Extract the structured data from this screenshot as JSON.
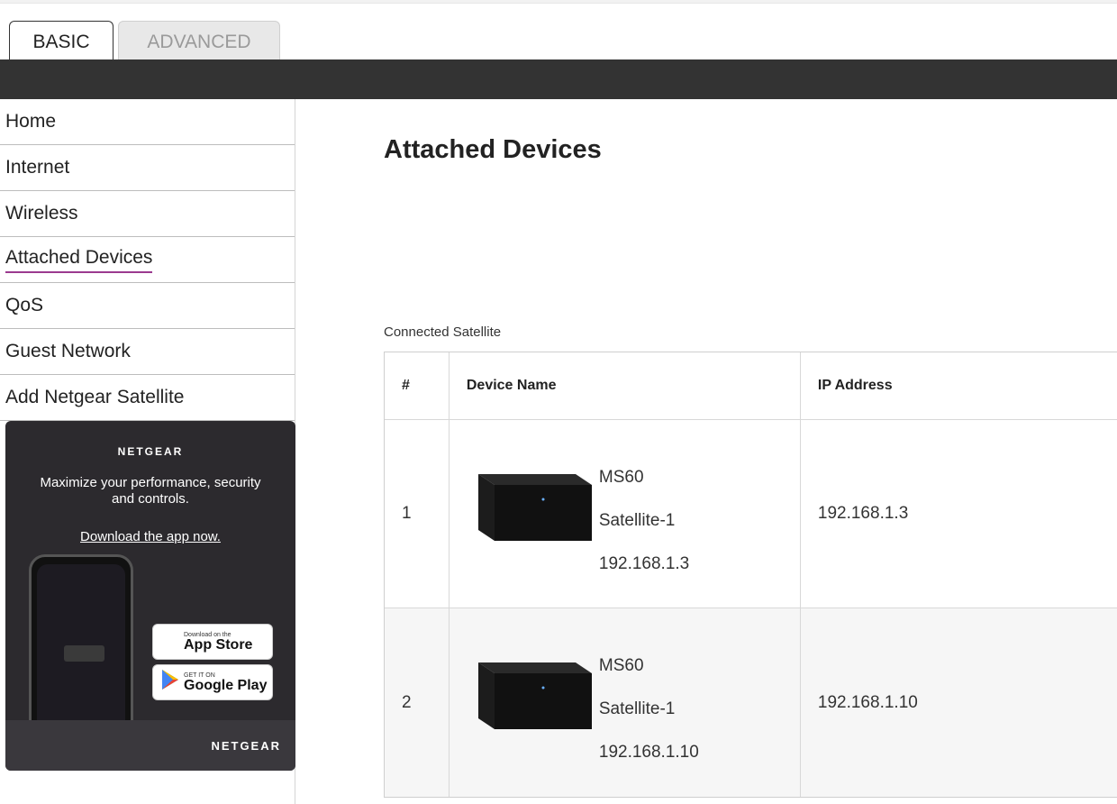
{
  "tabs": {
    "basic": "BASIC",
    "advanced": "ADVANCED"
  },
  "sidebar": {
    "items": [
      {
        "label": "Home"
      },
      {
        "label": "Internet"
      },
      {
        "label": "Wireless"
      },
      {
        "label": "Attached Devices"
      },
      {
        "label": "QoS"
      },
      {
        "label": "Guest Network"
      },
      {
        "label": "Add Netgear Satellite"
      }
    ],
    "active": "Attached Devices"
  },
  "promo": {
    "logo": "NETGEAR",
    "text": "Maximize your performance, security and controls.",
    "link": "Download the app now.",
    "apple_small": "Download on the",
    "apple_big": "App Store",
    "google_small": "GET IT ON",
    "google_big": "Google Play",
    "logo_bottom": "NETGEAR"
  },
  "main": {
    "title": "Attached Devices",
    "section": "Connected Satellite",
    "columns": [
      "#",
      "Device Name",
      "IP Address"
    ],
    "rows": [
      {
        "num": "1",
        "model": "MS60",
        "name": "Satellite-1",
        "ip_in_name": "192.168.1.3",
        "ip": "192.168.1.3"
      },
      {
        "num": "2",
        "model": "MS60",
        "name": "Satellite-1",
        "ip_in_name": "192.168.1.10",
        "ip": "192.168.1.10"
      }
    ]
  }
}
